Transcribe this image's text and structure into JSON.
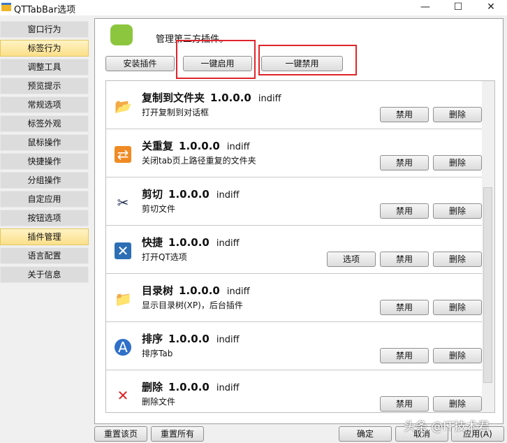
{
  "window": {
    "title": "QTTabBar选项",
    "minimize": "—",
    "maximize": "☐",
    "close": "✕"
  },
  "sidebar": {
    "items": [
      {
        "label": "窗口行为"
      },
      {
        "label": "标签行为",
        "active": true
      },
      {
        "label": "调整工具"
      },
      {
        "label": "预览提示"
      },
      {
        "label": "常规选项"
      },
      {
        "label": "标签外观"
      },
      {
        "label": "鼠标操作"
      },
      {
        "label": "快捷操作"
      },
      {
        "label": "分组操作"
      },
      {
        "label": "自定应用"
      },
      {
        "label": "按钮选项"
      },
      {
        "label": "插件管理",
        "active": true
      },
      {
        "label": "语言配置"
      },
      {
        "label": "关于信息"
      }
    ]
  },
  "main": {
    "header": "管理第三方插件。",
    "install": "安装插件",
    "enable_all": "一键启用",
    "disable_all": "一键禁用",
    "plugins": [
      {
        "name": "复制到文件夹",
        "version": "1.0.0.0",
        "author": "indiff",
        "desc": "打开复制到对话框",
        "icon": "copy-folder-icon",
        "options": false
      },
      {
        "name": "关重复",
        "version": "1.0.0.0",
        "author": "indiff",
        "desc": "关闭tab页上路径重复的文件夹",
        "icon": "dedupe-icon",
        "options": false
      },
      {
        "name": "剪切",
        "version": "1.0.0.0",
        "author": "indiff",
        "desc": "剪切文件",
        "icon": "scissors-icon",
        "options": false
      },
      {
        "name": "快捷",
        "version": "1.0.0.0",
        "author": "indiff",
        "desc": "打开QT选项",
        "icon": "tools-icon",
        "options": true
      },
      {
        "name": "目录树",
        "version": "1.0.0.0",
        "author": "indiff",
        "desc": "显示目录树(XP)，后台插件",
        "icon": "folder-tree-icon",
        "options": false
      },
      {
        "name": "排序",
        "version": "1.0.0.0",
        "author": "indiff",
        "desc": "排序Tab",
        "icon": "sort-icon",
        "options": false
      },
      {
        "name": "删除",
        "version": "1.0.0.0",
        "author": "indiff",
        "desc": "删除文件",
        "icon": "delete-icon",
        "options": false
      }
    ],
    "disable_label": "禁用",
    "delete_label": "删除",
    "options_label": "选项"
  },
  "footer": {
    "reset_page": "重置该页",
    "reset_all": "重置所有",
    "ok": "确定",
    "cancel": "取消",
    "apply": "应用(A)"
  },
  "watermark": "头条 @IT技术君"
}
